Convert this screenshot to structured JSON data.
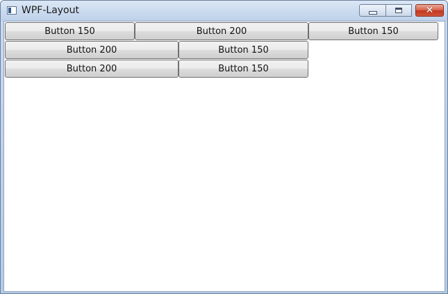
{
  "window": {
    "title": "WPF-Layout"
  },
  "titlebar": {
    "icon": "app-window-icon",
    "controls": {
      "minimize": "minimize-icon",
      "maximize": "maximize-icon",
      "close": "close-icon",
      "close_glyph": "✕"
    }
  },
  "rows": [
    {
      "buttons": [
        {
          "label": "Button 150"
        },
        {
          "label": "Button 200"
        },
        {
          "label": "Button 150"
        }
      ]
    },
    {
      "buttons": [
        {
          "label": "Button 200"
        },
        {
          "label": "Button 150"
        }
      ]
    },
    {
      "buttons": [
        {
          "label": "Button 200"
        },
        {
          "label": "Button 150"
        }
      ]
    }
  ],
  "colors": {
    "titlebar": "#c8d9ee",
    "close_button": "#c1381f",
    "client_background": "#ffffff"
  }
}
